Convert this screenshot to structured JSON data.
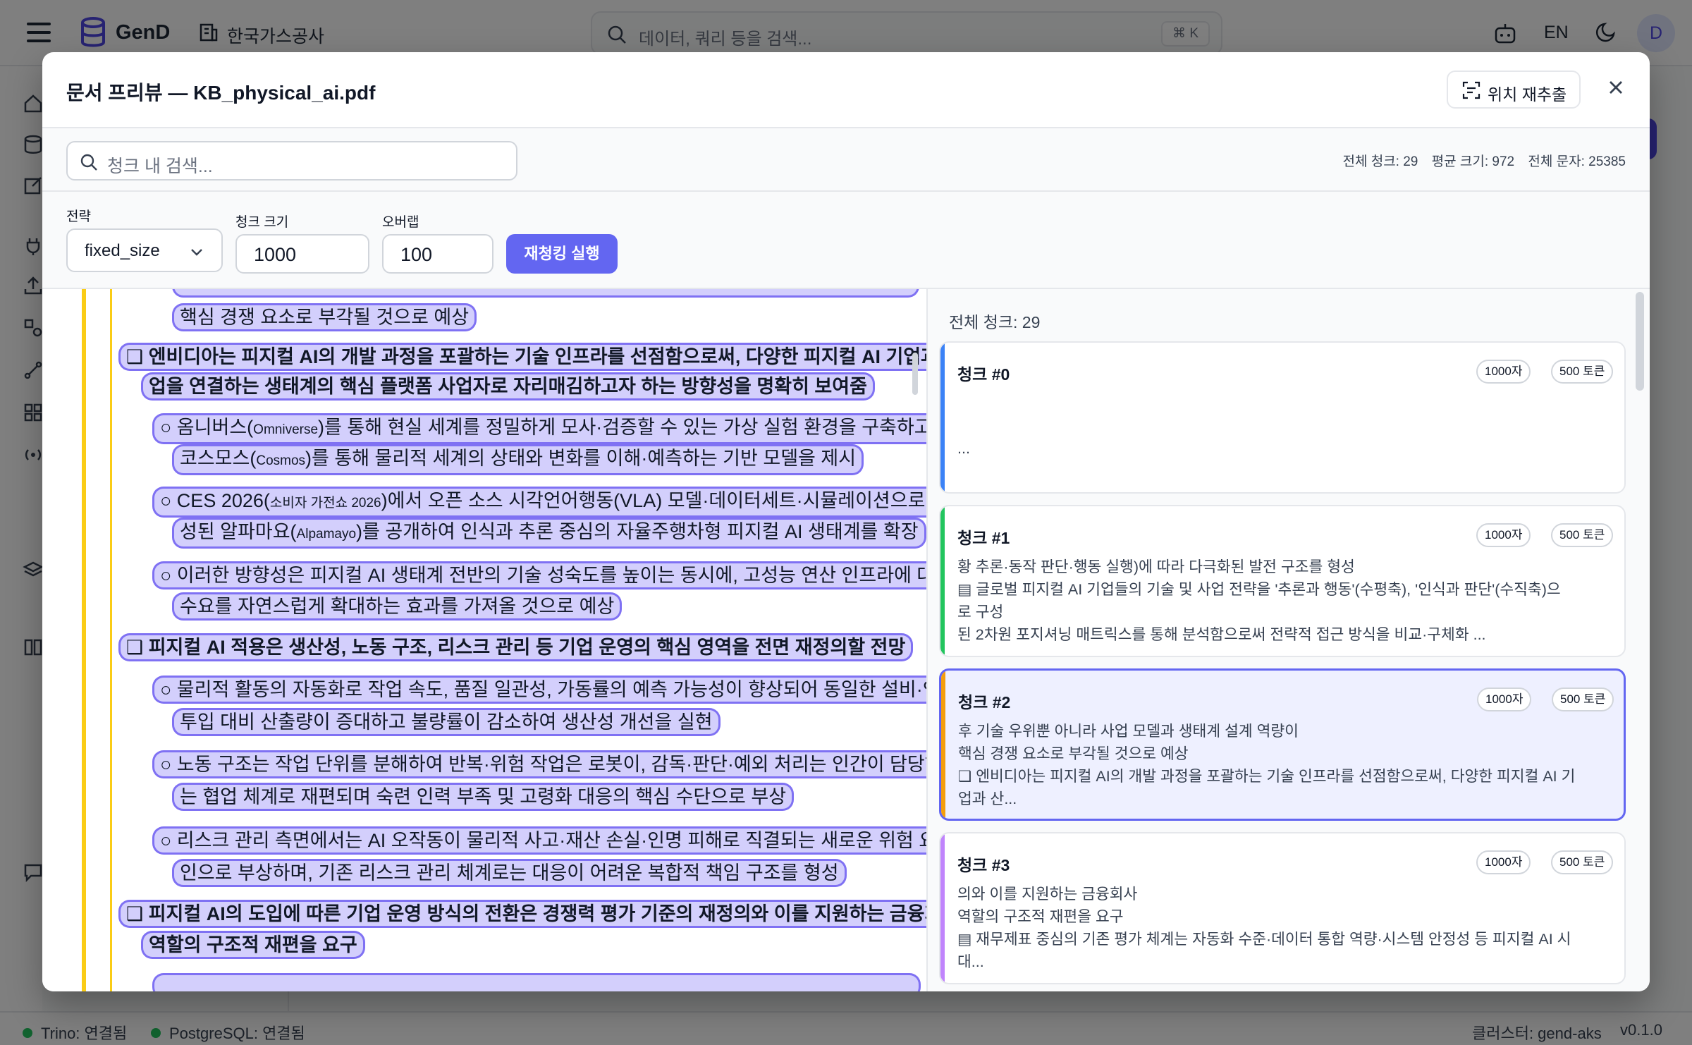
{
  "topbar": {
    "app_name": "GenD",
    "org_name": "한국가스공사",
    "search_placeholder": "데이터, 쿼리 등을 검색...",
    "search_shortcut": "⌘ K",
    "lang": "EN",
    "avatar_initial": "D"
  },
  "statusbar": {
    "trino": "Trino: 연결됨",
    "postgres": "PostgreSQL: 연결됨",
    "cluster": "클러스터: gend-aks",
    "version": "v0.1.0",
    "status_color": "#22c55e"
  },
  "modal": {
    "title": "문서 프리뷰 — KB_physical_ai.pdf",
    "reextract_label": "위치 재추출",
    "search_placeholder": "청크 내 검색...",
    "stats": {
      "total_chunks": "전체 청크: 29",
      "avg_size": "평균 크기: 972",
      "total_chars": "전체 문자: 25385"
    },
    "strategy_label": "전략",
    "strategy_value": "fixed_size",
    "chunk_size_label": "청크 크기",
    "chunk_size_value": "1000",
    "overlap_label": "오버랩",
    "overlap_value": "100",
    "rechunk_label": "재청킹 실행",
    "accent_color": "#6366f1"
  },
  "document": {
    "lines": [
      {
        "text": "핵심 경쟁 요소로 부각될 것으로 예상"
      },
      {
        "text": "❑ 엔비디아는 피지컬 AI의 개발 과정을 포괄하는 기술 인프라를 선점함으로써, 다양한 피지컬 AI 기업과 산"
      },
      {
        "text": "업을 연결하는 생태계의 핵심 플랫폼 사업자로 자리매김하고자 하는 방향성을 명확히 보여줌"
      },
      {
        "text_pre": "○ 옴니버스(",
        "text_small": "Omniverse",
        "text_post": ")를 통해 현실 세계를 정밀하게 모사·검증할 수 있는 가상 실험 환경을 구축하고,"
      },
      {
        "text_pre": "코스모스(",
        "text_small": "Cosmos",
        "text_post": ")를 통해 물리적 세계의 상태와 변화를 이해·예측하는 기반 모델을 제시"
      },
      {
        "text_pre": "○ CES 2026(",
        "text_small": "소비자 가전쇼 2026",
        "text_post": ")에서 오픈 소스 시각언어행동(VLA) 모델·데이터세트·시뮬레이션으로 구"
      },
      {
        "text_pre": "성된 알파마요(",
        "text_small": "Alpamayo",
        "text_post": ")를 공개하여 인식과 추론 중심의 자율주행차형 피지컬 AI 생태계를 확장"
      },
      {
        "text": "○ 이러한 방향성은 피지컬 AI 생태계 전반의 기술 성숙도를 높이는 동시에, 고성능 연산 인프라에 대한"
      },
      {
        "text": "수요를 자연스럽게 확대하는 효과를 가져올 것으로 예상"
      },
      {
        "text": "❑ 피지컬 AI 적용은 생산성, 노동 구조, 리스크 관리 등 기업 운영의 핵심 영역을 전면 재정의할 전망"
      },
      {
        "text": "○ 물리적 활동의 자동화로 작업 속도, 품질 일관성, 가동률의 예측 가능성이 향상되어 동일한 설비·인력"
      },
      {
        "text": "투입 대비 산출량이 증대하고 불량률이 감소하여 생산성 개선을 실현"
      },
      {
        "text": "○ 노동 구조는 작업 단위를 분해하여 반복·위험 작업은 로봇이, 감독·판단·예외 처리는 인간이 담당하"
      },
      {
        "text": "는 협업 체계로 재편되며 숙련 인력 부족 및 고령화 대응의 핵심 수단으로 부상"
      },
      {
        "text": "○ 리스크 관리 측면에서는 AI 오작동이 물리적 사고·재산 손실·인명 피해로 직결되는 새로운 위험 요"
      },
      {
        "text": "인으로 부상하며, 기존 리스크 관리 체계로는 대응이 어려운 복합적 책임 구조를 형성"
      },
      {
        "text": "❑ 피지컬 AI의 도입에 따른 기업 운영 방식의 전환은 경쟁력 평가 기준의 재정의와 이를 지원하는 금융회사"
      },
      {
        "text": "역할의 구조적 재편을 요구"
      }
    ]
  },
  "chunks": {
    "total_label": "전체 청크: 29",
    "items": [
      {
        "title": "청크 #0",
        "chars": "1000자",
        "tokens": "500 토큰",
        "color": "#3b82f6",
        "lines": [
          "",
          "",
          "..."
        ]
      },
      {
        "title": "청크 #1",
        "chars": "1000자",
        "tokens": "500 토큰",
        "color": "#22c55e",
        "lines": [
          "황 추론·동작 판단·행동 실행)에 따라 다극화된 발전 구조를 형성",
          "▤ 글로벌 피지컬 AI 기업들의 기술 및 사업 전략을 '추론과 행동'(수평축), '인식과 판단'(수직축)으",
          "로 구성",
          "된 2차원 포지셔닝 매트릭스를 통해 분석함으로써 전략적 접근 방식을 비교·구체화 ..."
        ]
      },
      {
        "title": "청크 #2",
        "chars": "1000자",
        "tokens": "500 토큰",
        "color": "#f59e0b",
        "lines": [
          "후 기술 우위뿐 아니라 사업 모델과 생태계 설계 역량이",
          "핵심 경쟁 요소로 부각될 것으로 예상",
          "❑ 엔비디아는 피지컬 AI의 개발 과정을 포괄하는 기술 인프라를 선점함으로써, 다양한 피지컬 AI 기",
          "업과 산..."
        ]
      },
      {
        "title": "청크 #3",
        "chars": "1000자",
        "tokens": "500 토큰",
        "color": "#c084fc",
        "lines": [
          "의와 이를 지원하는 금융회사",
          "역할의 구조적 재편을 요구",
          "▤ 재무제표 중심의 기존 평가 체계는 자동화 수준·데이터 통합 역량·시스템 안정성 등 피지컬 AI 시",
          "대..."
        ]
      }
    ]
  }
}
